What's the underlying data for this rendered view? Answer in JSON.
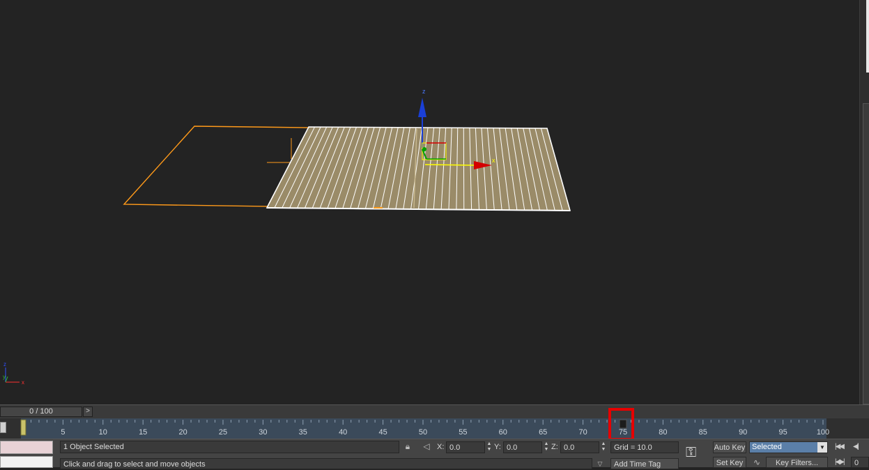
{
  "timeslider": {
    "frame_label": "0 / 100",
    "next_arrow": ">"
  },
  "trackbar": {
    "labels": [
      "5",
      "10",
      "15",
      "20",
      "25",
      "30",
      "35",
      "40",
      "45",
      "50",
      "55",
      "60",
      "65",
      "70",
      "75",
      "80",
      "85",
      "90",
      "95",
      "100"
    ],
    "current_frame": 0,
    "max_frame": 100,
    "key_frame": 75
  },
  "status": {
    "selection": "1 Object Selected",
    "prompt": "Click and drag to select and move objects",
    "x_label": "X:",
    "x_value": "0.0",
    "y_label": "Y:",
    "y_value": "0.0",
    "z_label": "Z:",
    "z_value": "0.0",
    "grid": "Grid = 10.0",
    "add_time_tag": "Add Time Tag"
  },
  "animation": {
    "auto_key": "Auto Key",
    "set_key": "Set Key",
    "selected_option": "Selected",
    "key_filters": "Key Filters...",
    "frame_value": "0"
  },
  "axis_labels": {
    "x": "x",
    "y": "y",
    "z": "z"
  },
  "colors": {
    "viewport_bg": "#232323",
    "plane_fill": "#9a8b68",
    "plane_wire": "#ffffff",
    "selection_orange": "#ff9a1a",
    "gizmo_x": "#d40000",
    "gizmo_y": "#00a000",
    "gizmo_z": "#1a3fd6",
    "highlight": "#e60000"
  }
}
